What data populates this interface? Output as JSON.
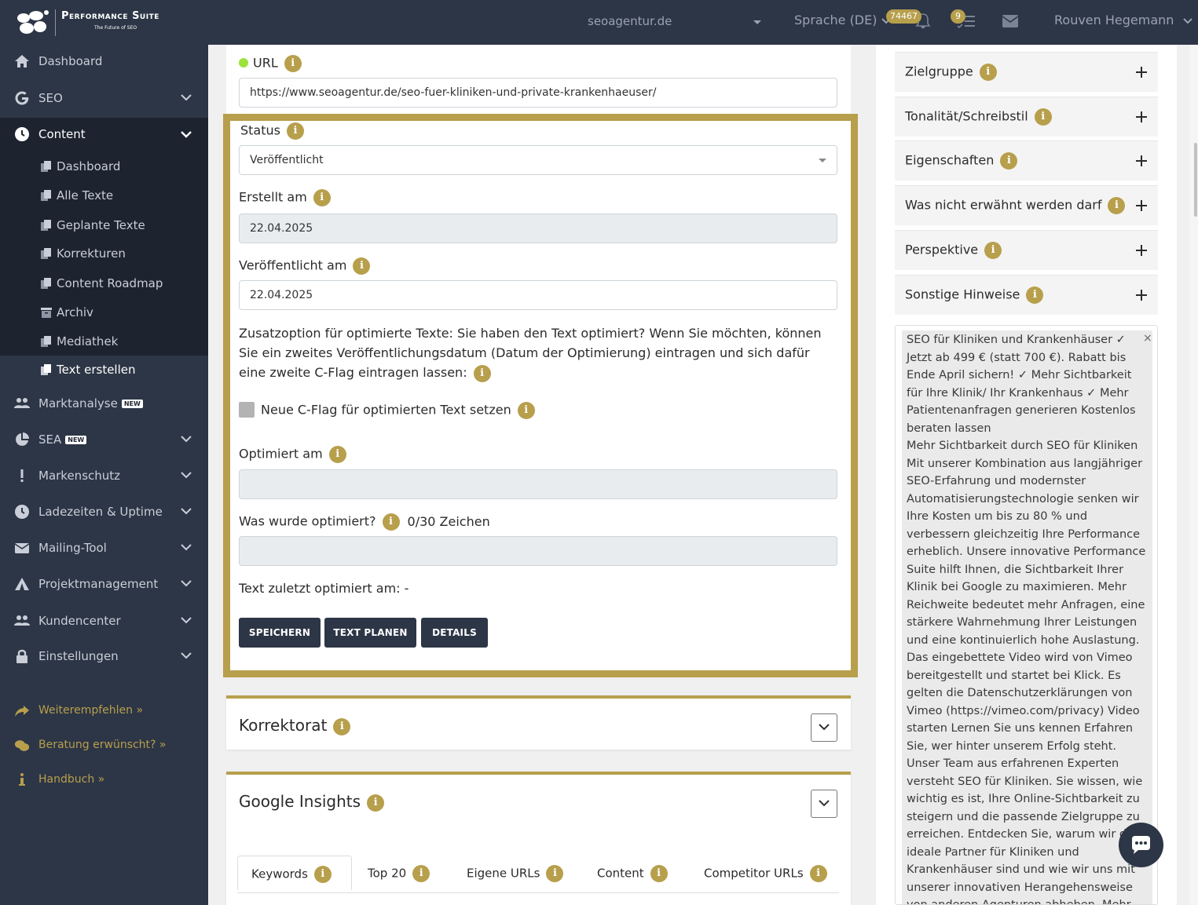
{
  "header": {
    "brand_title": "Performance Suite",
    "brand_subtitle": "The Future of SEO",
    "domain": "seoagentur.de",
    "language": "Sprache (DE)",
    "notifications_count": "74467",
    "tasks_count": "9",
    "user_name": "Rouven Hegemann"
  },
  "sidebar": {
    "items": [
      {
        "label": "Dashboard",
        "icon": "home-icon"
      },
      {
        "label": "SEO",
        "icon": "google-icon"
      },
      {
        "label": "Content",
        "icon": "clock-icon"
      },
      {
        "label": "Marktanalyse",
        "icon": "users-icon",
        "tag": "NEW"
      },
      {
        "label": "SEA",
        "icon": "pie-chart-icon",
        "tag": "NEW"
      },
      {
        "label": "Markenschutz",
        "icon": "exclamation-icon"
      },
      {
        "label": "Ladezeiten & Uptime",
        "icon": "clock-icon"
      },
      {
        "label": "Mailing-Tool",
        "icon": "mail-icon"
      },
      {
        "label": "Projektmanagement",
        "icon": "tent-icon"
      },
      {
        "label": "Kundencenter",
        "icon": "users-icon"
      },
      {
        "label": "Einstellungen",
        "icon": "lock-icon"
      }
    ],
    "submenu": [
      {
        "label": "Dashboard",
        "icon": "copy-icon"
      },
      {
        "label": "Alle Texte",
        "icon": "copy-icon"
      },
      {
        "label": "Geplante Texte",
        "icon": "copy-icon"
      },
      {
        "label": "Korrekturen",
        "icon": "copy-icon"
      },
      {
        "label": "Content Roadmap",
        "icon": "copy-icon"
      },
      {
        "label": "Archiv",
        "icon": "archive-icon"
      },
      {
        "label": "Mediathek",
        "icon": "copy-icon"
      },
      {
        "label": "Text erstellen",
        "icon": "copy-icon"
      }
    ],
    "links": [
      {
        "label": "Weiterempfehlen »",
        "icon": "share-icon"
      },
      {
        "label": "Beratung erwünscht? »",
        "icon": "chat-icon"
      },
      {
        "label": "Handbuch »",
        "icon": "info-icon"
      }
    ]
  },
  "form": {
    "url_label": "URL",
    "url_value": "https://www.seoagentur.de/seo-fuer-kliniken-und-private-krankenhaeuser/",
    "status_label": "Status",
    "status_value": "Veröffentlicht",
    "created_label": "Erstellt am",
    "created_value": "22.04.2025",
    "published_label": "Veröffentlicht am",
    "published_value": "22.04.2025",
    "option_text": "Zusatzoption für optimierte Texte: Sie haben den Text optimiert? Wenn Sie möchten, können Sie ein zweites Veröffentlichungsdatum (Datum der Optimierung) eintragen und sich dafür eine zweite C-Flag eintragen lassen:",
    "cflag_label": "Neue C-Flag für optimierten Text setzen",
    "optimized_label": "Optimiert am",
    "optimized_value": "",
    "what_label": "Was wurde optimiert?",
    "what_counter": "0/30 Zeichen",
    "what_value": "",
    "last_optimized": "Text zuletzt optimiert am: -",
    "btn_save": "SPEICHERN",
    "btn_plan": "TEXT PLANEN",
    "btn_details": "DETAILS"
  },
  "sections": {
    "korrektorat": "Korrektorat",
    "insights": "Google Insights",
    "tabs": [
      "Keywords",
      "Top 20",
      "Eigene URLs",
      "Content",
      "Competitor URLs"
    ]
  },
  "right": {
    "accordions": [
      "Zielgruppe",
      "Tonalität/Schreibstil",
      "Eigenschaften",
      "Was nicht erwähnt werden darf",
      "Perspektive",
      "Sonstige Hinweise"
    ],
    "text_content": "SEO für Kliniken und Krankenhäuser ✓ Jetzt ab 499 € (statt 700 €). Rabatt bis Ende April sichern! ✓ Mehr Sichtbarkeit für Ihre Klinik/ Ihr Krankenhaus ✓ Mehr Patientenanfragen generieren Kostenlos beraten lassen\nMehr Sichtbarkeit durch SEO für Kliniken Mit unserer Kombination aus langjähriger SEO-Erfahrung und modernster Automatisierungstechnologie senken wir Ihre Kosten um bis zu 80 % und verbessern gleichzeitig Ihre Performance erheblich. Unsere innovative Performance Suite hilft Ihnen, die Sichtbarkeit Ihrer Klinik bei Google zu maximieren. Mehr Reichweite bedeutet mehr Anfragen, eine stärkere Wahrnehmung Ihrer Leistungen und eine kontinuierlich hohe Auslastung. Das eingebettete Video wird von Vimeo bereitgestellt und startet bei Klick. Es gelten die Datenschutzerklärungen von Vimeo (https://vimeo.com/privacy) Video starten Lernen Sie uns kennen Erfahren Sie, wer hinter unserem Erfolg steht. Unser Team aus erfahrenen Experten versteht SEO für Kliniken. Sie wissen, wie wichtig es ist, Ihre Online-Sichtbarkeit zu steigern und die passende Zielgruppe zu erreichen. Entdecken Sie, warum wir der ideale Partner für Kliniken und Krankenhäuser sind und wie wir uns mit unserer innovativen Herangehensweise von anderen Agenturen abheben. Mehr Aufträge",
    "close_symbol": "×"
  },
  "colors": {
    "dark": "#2d3646",
    "darker": "#1d2430",
    "gold": "#b79f4c",
    "status_dot": "#9be33a"
  }
}
